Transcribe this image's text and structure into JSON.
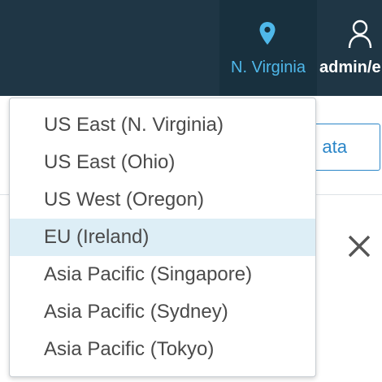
{
  "header": {
    "region_label": "N. Virginia",
    "region_icon": "map-pin-icon",
    "user_label": "admin/e",
    "user_icon": "user-icon"
  },
  "background": {
    "button_label": "ata",
    "close_icon": "close-icon"
  },
  "region_menu": {
    "selected": "EU (Ireland)",
    "items": [
      {
        "label": "US East (N. Virginia)"
      },
      {
        "label": "US East (Ohio)"
      },
      {
        "label": "US West (Oregon)"
      },
      {
        "label": "EU (Ireland)"
      },
      {
        "label": "Asia Pacific (Singapore)"
      },
      {
        "label": "Asia Pacific (Sydney)"
      },
      {
        "label": "Asia Pacific (Tokyo)"
      }
    ]
  },
  "colors": {
    "header_bg": "#1f3645",
    "accent": "#4fb8ea",
    "selected_bg": "#ddeef6"
  }
}
